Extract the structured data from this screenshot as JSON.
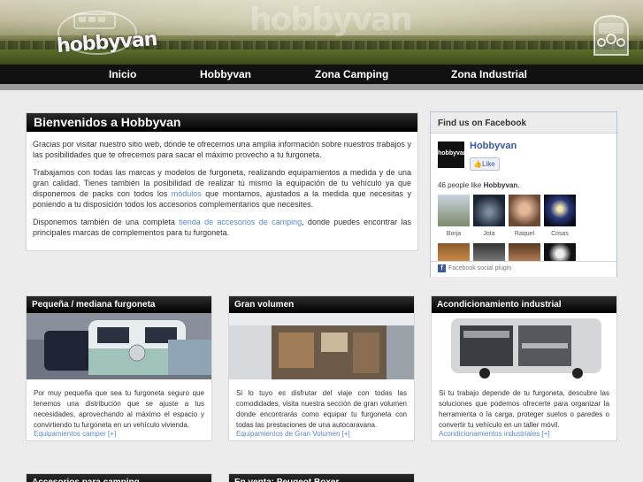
{
  "brand": {
    "logo_text": "hobbyvan",
    "watermark": "hobbyvan"
  },
  "nav": {
    "items": [
      "Inicio",
      "Hobbyvan",
      "Zona Camping",
      "Zona Industrial"
    ]
  },
  "welcome": {
    "title": "Bienvenidos a Hobbyvan",
    "p1": "Gracias por visitar nuestro sitio web, dónde te ofrecemos una amplia información sobre nuestros trabajos y las posibilidades que te ofrecemos para sacar el máximo provecho a tu furgoneta.",
    "p2_a": "Trabajamos con todas las marcas y modelos de furgoneta, realizando equipamientos a medida y de una gran calidad. Tienes también la posibilidad de realizar tú mismo la equipación de tu vehículo ya que disponemos de packs con todos los ",
    "p2_link": "módulos",
    "p2_b": " que montamos, ajustados a la medida que necesitas y poniendo a tu disposición todos los accesorios complementarios que necesites.",
    "p3_a": "Disponemos también de una completa ",
    "p3_link": "tienda de accesorios de camping",
    "p3_b": ", donde puedes encontrar las principales marcas de complementos para tu furgoneta."
  },
  "facebook": {
    "header": "Find us on Facebook",
    "page_name": "Hobbyvan",
    "like_label": "Like",
    "likes_prefix": "46 people like ",
    "likes_name": "Hobbyvan",
    "likes_suffix": ".",
    "fans": [
      "Borja",
      "Jota",
      "Raquel",
      "Cosas"
    ],
    "plugin_label": "Facebook social plugin"
  },
  "cards": [
    {
      "title": "Pequeña / mediana furgoneta",
      "text": "Por muy pequeña que sea tu furgoneta seguro que tenemos una distribución que se ajuste a tus necesidades, aprovechando al máximo el espacio y convirtiendo tu furgoneta en un vehículo vivienda.",
      "link": "Equipamientos camper [+]"
    },
    {
      "title": "Gran volumen",
      "text": "Si lo tuyo es disfrutar del viaje con todas las comodidades, visita nuestra sección de gran volumen donde encontrarás como equipar tu furgoneta con todas las prestaciones de una autocaravana.",
      "link": "Equipamientos de Gran Volumen [+]"
    },
    {
      "title": "Acondicionamiento industrial",
      "text": "Si tu trabajo depende de tu furgoneta, descubre las soluciones que podemos ofrecerte para organizar la herramienta o la carga, proteger suelos o paredes o convertir tu vehículo en un taller móvil.",
      "link": "Acondicionamientos industriales [+]"
    }
  ],
  "bottom_cards": [
    "Accesorios para camping",
    "En venta: Peugeot Boxer"
  ]
}
